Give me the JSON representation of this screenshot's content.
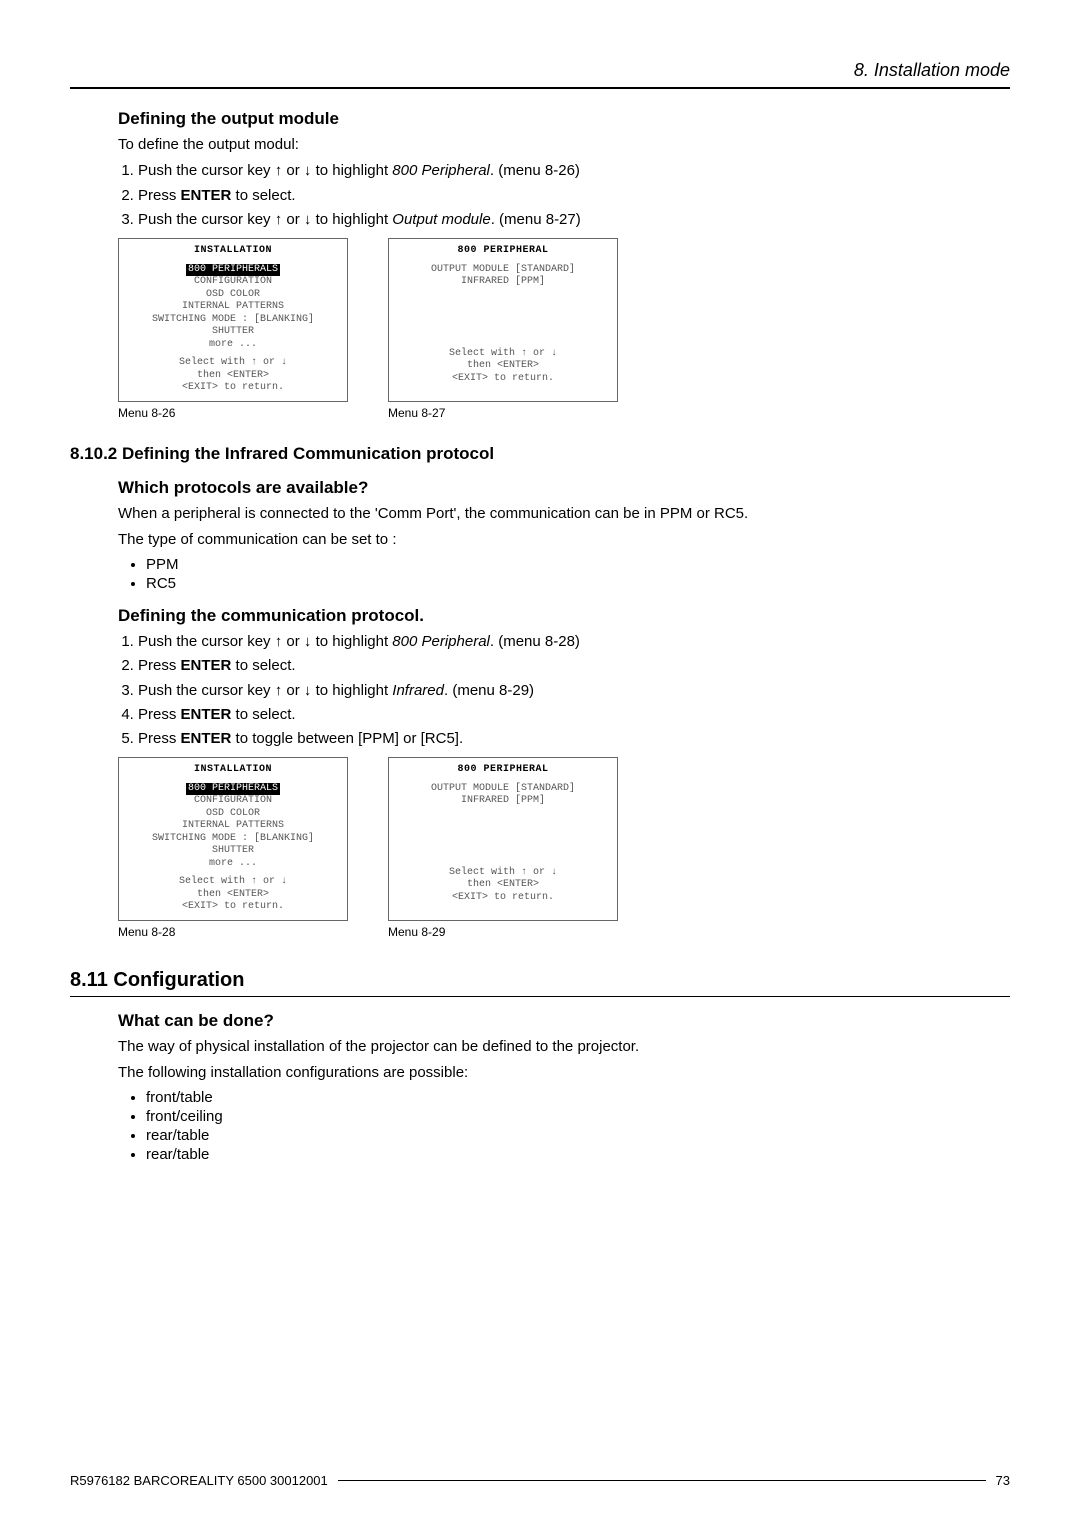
{
  "header": {
    "title": "8. Installation mode"
  },
  "s1": {
    "title": "Defining the output module",
    "intro": "To define the output modul:",
    "step1a": "Push the cursor key ↑ or ↓ to highlight ",
    "step1b": "800 Peripheral",
    "step1c": ". (menu 8-26)",
    "step2a": "Press ",
    "step2b": "ENTER",
    "step2c": " to select.",
    "step3a": "Push the cursor key ↑ or ↓ to highlight ",
    "step3b": "Output module",
    "step3c": ". (menu 8-27)"
  },
  "menu_install_title": "INSTALLATION",
  "menu_install": {
    "l1": "800 PERIPHERALS",
    "l2": "CONFIGURATION",
    "l3": "OSD COLOR",
    "l4": "INTERNAL PATTERNS",
    "l5": "SWITCHING MODE : [BLANKING]",
    "l6": "SHUTTER",
    "l7": "more ..."
  },
  "menu_periph_title": "800 PERIPHERAL",
  "menu_periph": {
    "l1": "OUTPUT MODULE [STANDARD]",
    "l2": "INFRARED [PPM]"
  },
  "menu_footer": {
    "f1": "Select with ↑ or ↓",
    "f2": "then <ENTER>",
    "f3": "<EXIT> to return."
  },
  "cap": {
    "m826": "Menu 8-26",
    "m827": "Menu 8-27",
    "m828": "Menu 8-28",
    "m829": "Menu 8-29"
  },
  "s2": {
    "num_title": "8.10.2 Defining the Infrared Communication protocol",
    "q_title": "Which protocols are available?",
    "q_p1": "When a peripheral is connected to the 'Comm Port', the communication can be in PPM or RC5.",
    "q_p2": "The type of communication can be set to :",
    "b1": "PPM",
    "b2": "RC5",
    "d_title": "Defining the communication protocol.",
    "step1a": "Push the cursor key ↑ or ↓ to highlight ",
    "step1b": "800 Peripheral",
    "step1c": ". (menu 8-28)",
    "step2a": "Press ",
    "step2b": "ENTER",
    "step2c": " to select.",
    "step3a": "Push the cursor key ↑ or ↓ to highlight ",
    "step3b": "Infrared",
    "step3c": ". (menu 8-29)",
    "step4a": "Press ",
    "step4b": "ENTER",
    "step4c": " to select.",
    "step5a": "Press ",
    "step5b": "ENTER",
    "step5c": " to toggle between [PPM] or [RC5]."
  },
  "s3": {
    "title": "8.11 Configuration",
    "q_title": "What can be done?",
    "p1": "The way of physical installation of the projector can be defined to the projector.",
    "p2": "The following installation configurations are possible:",
    "b1": "front/table",
    "b2": "front/ceiling",
    "b3": "rear/table",
    "b4": "rear/table"
  },
  "footer": {
    "left": "R5976182  BARCOREALITY 6500  30012001",
    "right": "73"
  }
}
